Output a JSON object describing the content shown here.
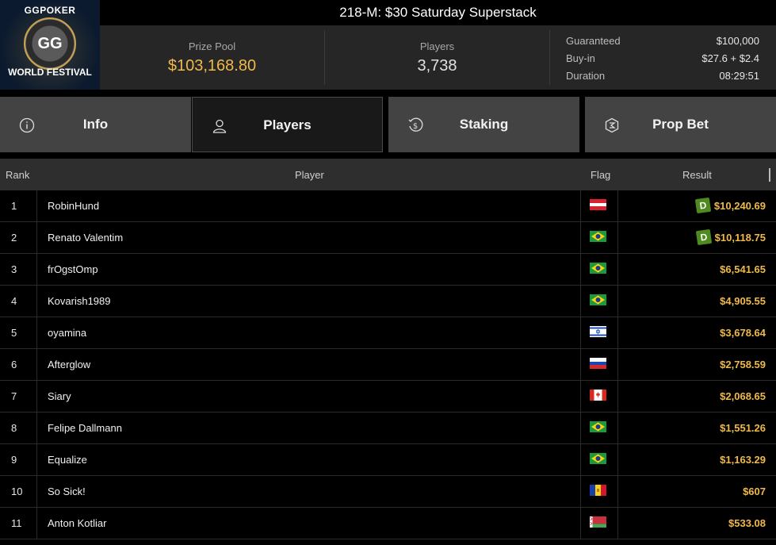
{
  "logo": {
    "top_text": "GGPOKER",
    "bottom_text": "WORLD FESTIVAL",
    "mark": "GG"
  },
  "title": "218-M: $30 Saturday Superstack",
  "stats": {
    "prize_pool_label": "Prize Pool",
    "prize_pool": "$103,168.80",
    "players_label": "Players",
    "players": "3,738",
    "details": [
      {
        "key": "Guaranteed",
        "value": "$100,000"
      },
      {
        "key": "Buy-in",
        "value": "$27.6 + $2.4"
      },
      {
        "key": "Duration",
        "value": "08:29:51"
      }
    ]
  },
  "tabs": [
    {
      "label": "Info",
      "icon": "info-circle-icon",
      "active": false
    },
    {
      "label": "Players",
      "icon": "user-icon",
      "active": true
    },
    {
      "label": "Staking",
      "icon": "staking-dollar-icon",
      "active": false
    },
    {
      "label": "Prop Bet",
      "icon": "prop-bet-icon",
      "active": false
    }
  ],
  "table": {
    "headers": {
      "rank": "Rank",
      "player": "Player",
      "flag": "Flag",
      "result": "Result"
    },
    "rows": [
      {
        "rank": "1",
        "player": "RobinHund",
        "flag": "austria",
        "badge": "D",
        "result": "$10,240.69"
      },
      {
        "rank": "2",
        "player": "Renato Valentim",
        "flag": "brazil",
        "badge": "D",
        "result": "$10,118.75"
      },
      {
        "rank": "3",
        "player": "frOgstOmp",
        "flag": "brazil",
        "badge": "",
        "result": "$6,541.65"
      },
      {
        "rank": "4",
        "player": "Kovarish1989",
        "flag": "brazil",
        "badge": "",
        "result": "$4,905.55"
      },
      {
        "rank": "5",
        "player": "oyamina",
        "flag": "israel",
        "badge": "",
        "result": "$3,678.64"
      },
      {
        "rank": "6",
        "player": "Afterglow",
        "flag": "russia",
        "badge": "",
        "result": "$2,758.59"
      },
      {
        "rank": "7",
        "player": "Siary",
        "flag": "canada",
        "badge": "",
        "result": "$2,068.65"
      },
      {
        "rank": "8",
        "player": "Felipe Dallmann",
        "flag": "brazil",
        "badge": "",
        "result": "$1,551.26"
      },
      {
        "rank": "9",
        "player": "Equalize",
        "flag": "brazil",
        "badge": "",
        "result": "$1,163.29"
      },
      {
        "rank": "10",
        "player": "So Sick!",
        "flag": "andorra",
        "badge": "",
        "result": "$607"
      },
      {
        "rank": "11",
        "player": "Anton Kotliar",
        "flag": "belarus",
        "badge": "",
        "result": "$533.08"
      }
    ]
  },
  "colors": {
    "gold": "#f0b94a",
    "tab_bg": "#434343",
    "active_tab_bg": "#191919",
    "badge_green": "#4e8a1f"
  }
}
